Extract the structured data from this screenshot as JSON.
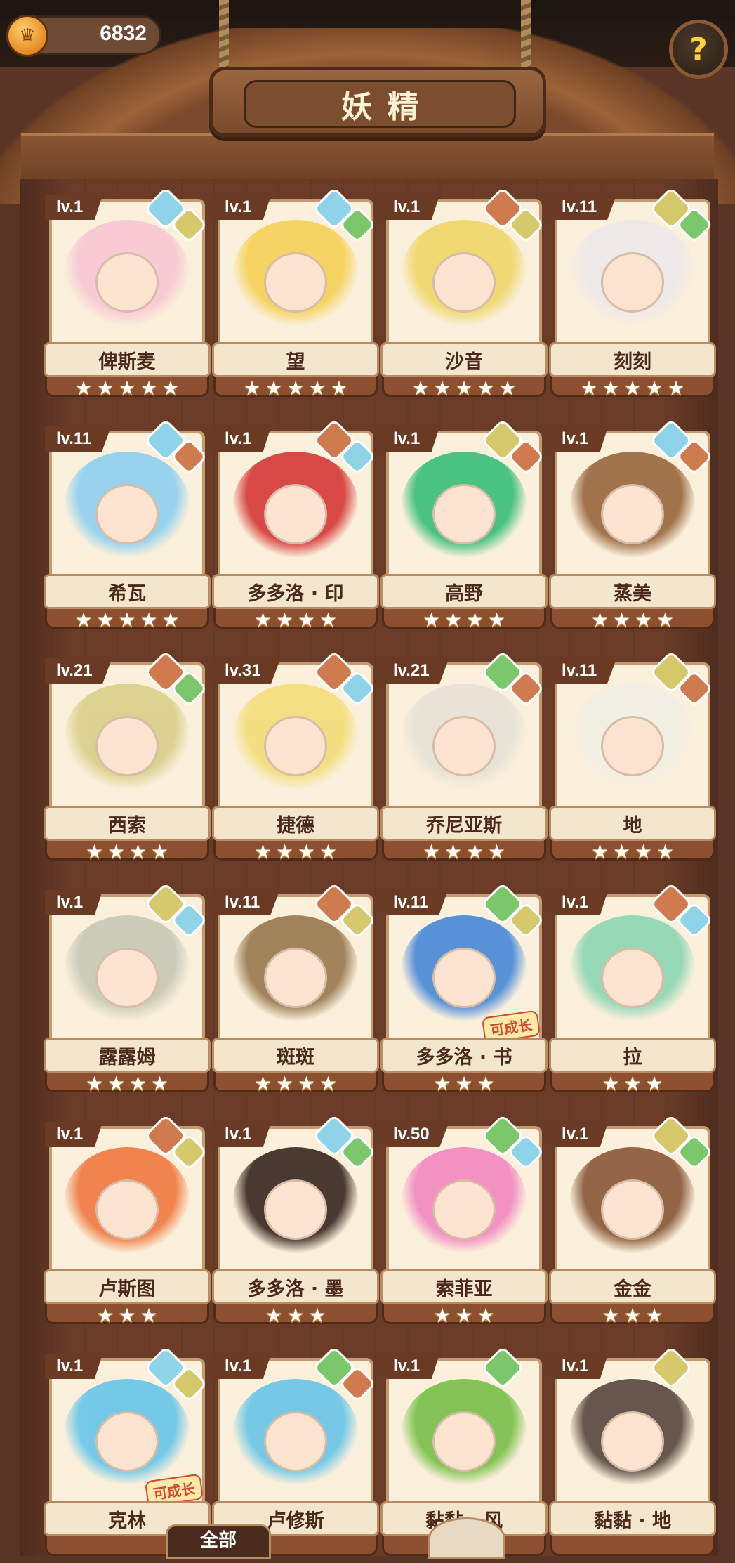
{
  "header": {
    "coins": "6832",
    "title": "妖精",
    "help_icon": "question-mark-icon",
    "coin_icon": "crown-coin-icon"
  },
  "colors": {
    "water": "#8fd3e8",
    "earth": "#d07a50",
    "light": "#d6c86c",
    "grass": "#7cc66c"
  },
  "fairies": [
    {
      "level": "lv.1",
      "name": "俾斯麦",
      "stars": 5,
      "elements": [
        "water",
        "light"
      ],
      "tint": "#f7c7d4"
    },
    {
      "level": "lv.1",
      "name": "望",
      "stars": 5,
      "elements": [
        "water",
        "grass"
      ],
      "tint": "#f5d25a"
    },
    {
      "level": "lv.1",
      "name": "沙音",
      "stars": 5,
      "elements": [
        "earth",
        "light"
      ],
      "tint": "#f0d66a"
    },
    {
      "level": "lv.11",
      "name": "刻刻",
      "stars": 5,
      "elements": [
        "light",
        "grass"
      ],
      "tint": "#efe9ea"
    },
    {
      "level": "lv.11",
      "name": "希瓦",
      "stars": 5,
      "elements": [
        "water",
        "earth"
      ],
      "tint": "#8fd0f0"
    },
    {
      "level": "lv.1",
      "name": "多多洛 · 印",
      "stars": 4,
      "elements": [
        "earth",
        "water"
      ],
      "tint": "#d63a3a"
    },
    {
      "level": "lv.1",
      "name": "高野",
      "stars": 4,
      "elements": [
        "light",
        "earth"
      ],
      "tint": "#3cbf7a"
    },
    {
      "level": "lv.1",
      "name": "蒸美",
      "stars": 4,
      "elements": [
        "water",
        "earth"
      ],
      "tint": "#9a6a42"
    },
    {
      "level": "lv.21",
      "name": "西索",
      "stars": 4,
      "elements": [
        "earth",
        "grass"
      ],
      "tint": "#d9d08c"
    },
    {
      "level": "lv.31",
      "name": "捷德",
      "stars": 4,
      "elements": [
        "earth",
        "water"
      ],
      "tint": "#f3de7a"
    },
    {
      "level": "lv.21",
      "name": "乔尼亚斯",
      "stars": 4,
      "elements": [
        "grass",
        "earth"
      ],
      "tint": "#e6e2d6"
    },
    {
      "level": "lv.11",
      "name": "地",
      "stars": 4,
      "elements": [
        "light",
        "earth"
      ],
      "tint": "#f2efe4"
    },
    {
      "level": "lv.1",
      "name": "露露姆",
      "stars": 4,
      "elements": [
        "light",
        "water"
      ],
      "tint": "#c9c9b8"
    },
    {
      "level": "lv.11",
      "name": "斑斑",
      "stars": 4,
      "elements": [
        "earth",
        "light"
      ],
      "tint": "#9a7a52"
    },
    {
      "level": "lv.11",
      "name": "多多洛 · 书",
      "stars": 3,
      "elements": [
        "grass",
        "light"
      ],
      "tint": "#4a8ad8",
      "grow": "可成长"
    },
    {
      "level": "lv.1",
      "name": "拉",
      "stars": 3,
      "elements": [
        "earth",
        "water"
      ],
      "tint": "#8fd6b4"
    },
    {
      "level": "lv.1",
      "name": "卢斯图",
      "stars": 3,
      "elements": [
        "earth",
        "light"
      ],
      "tint": "#f07a42"
    },
    {
      "level": "lv.1",
      "name": "多多洛 · 墨",
      "stars": 3,
      "elements": [
        "water",
        "grass"
      ],
      "tint": "#3a2a22"
    },
    {
      "level": "lv.50",
      "name": "索菲亚",
      "stars": 3,
      "elements": [
        "grass",
        "water"
      ],
      "tint": "#f28ac0"
    },
    {
      "level": "lv.1",
      "name": "金金",
      "stars": 3,
      "elements": [
        "light",
        "grass"
      ],
      "tint": "#8a5a3a"
    },
    {
      "level": "lv.1",
      "name": "克林",
      "stars": 0,
      "elements": [
        "water",
        "light"
      ],
      "tint": "#6ac6ea",
      "grow": "可成长"
    },
    {
      "level": "lv.1",
      "name": "卢修斯",
      "stars": 0,
      "elements": [
        "grass",
        "earth"
      ],
      "tint": "#6ac6e8"
    },
    {
      "level": "lv.1",
      "name": "黏黏 · 风",
      "stars": 0,
      "elements": [
        "grass"
      ],
      "tint": "#7ac04a"
    },
    {
      "level": "lv.1",
      "name": "黏黏 · 地",
      "stars": 0,
      "elements": [
        "light"
      ],
      "tint": "#5a4a42"
    }
  ],
  "bottom": {
    "tab_all": "全部"
  }
}
